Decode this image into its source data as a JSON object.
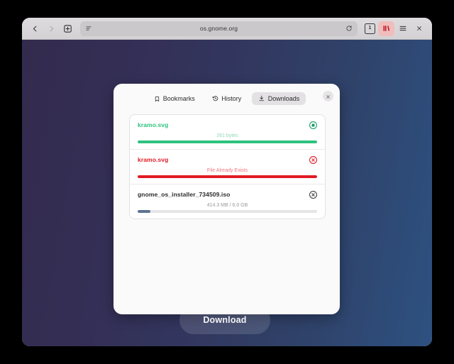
{
  "browser": {
    "nav": {
      "back_icon": "chevron-left-icon",
      "forward_icon": "chevron-right-icon",
      "new_tab_icon": "plus-square-icon"
    },
    "urlbar": {
      "url": "os.gnome.org",
      "reader_icon": "reader-mode-icon",
      "reload_icon": "reload-icon"
    },
    "actions": {
      "tab_count": "1",
      "library_icon": "library-icon",
      "menu_icon": "hamburger-menu-icon",
      "close_icon": "close-icon"
    }
  },
  "popover": {
    "tabs": [
      {
        "label": "Bookmarks",
        "icon": "bookmark-icon",
        "active": false
      },
      {
        "label": "History",
        "icon": "history-clock-icon",
        "active": false
      },
      {
        "label": "Downloads",
        "icon": "download-arrow-icon",
        "active": true
      }
    ],
    "close_icon": "close-icon",
    "downloads": [
      {
        "filename": "kramo.svg",
        "status": "261 bytes",
        "progress": 100,
        "state": "complete",
        "name_color": "#2ec27e",
        "status_color": "#8fd9b6",
        "bar_color": "#2ec27e",
        "action_icon": "stop-circle-icon",
        "action_color": "#1a9b66"
      },
      {
        "filename": "kramo.svg",
        "status": "File Already Exists",
        "progress": 100,
        "state": "error",
        "name_color": "#e01b24",
        "status_color": "#f07179",
        "bar_color": "#e01b24",
        "action_icon": "cancel-circle-icon",
        "action_color": "#e01b24"
      },
      {
        "filename": "gnome_os_installer_734509.iso",
        "status": "414.3 MB / 6.0 GB",
        "progress": 7,
        "state": "downloading",
        "name_color": "#2b2b2b",
        "status_color": "#9a999a",
        "bar_color": "#5f7491",
        "action_icon": "cancel-circle-icon",
        "action_color": "#3a383a"
      }
    ]
  },
  "page": {
    "download_button_label": "Download"
  },
  "colors": {
    "accent_green": "#2ec27e",
    "accent_red": "#e01b24",
    "accent_blue_gray": "#5f7491",
    "gradient_start": "#332b4e",
    "gradient_end": "#2e5181",
    "library_highlight": "#f0bdbd"
  }
}
